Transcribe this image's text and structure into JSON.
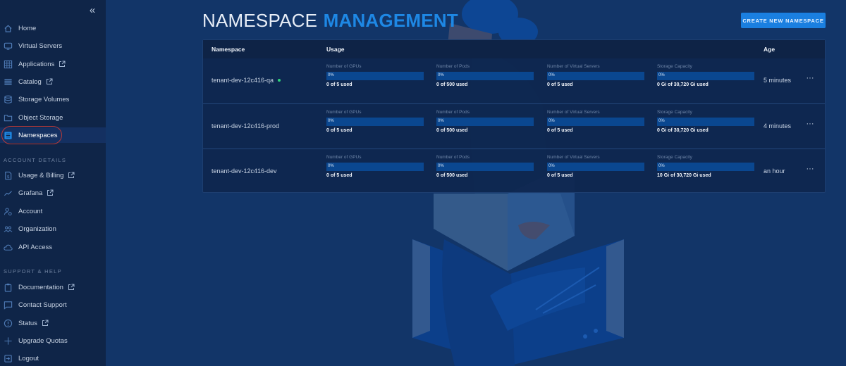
{
  "sidebar": {
    "collapse_label": "«",
    "items": [
      {
        "label": "Home",
        "icon": "home-icon",
        "external": false
      },
      {
        "label": "Virtual Servers",
        "icon": "monitor-icon",
        "external": false
      },
      {
        "label": "Applications",
        "icon": "grid-icon",
        "external": true
      },
      {
        "label": "Catalog",
        "icon": "list-icon",
        "external": true
      },
      {
        "label": "Storage Volumes",
        "icon": "database-icon",
        "external": false
      },
      {
        "label": "Object Storage",
        "icon": "folder-icon",
        "external": false
      },
      {
        "label": "Namespaces",
        "icon": "namespace-icon",
        "external": false,
        "active": true
      }
    ],
    "account_section": {
      "title": "ACCOUNT DETAILS",
      "items": [
        {
          "label": "Usage & Billing",
          "icon": "invoice-icon",
          "external": true
        },
        {
          "label": "Grafana",
          "icon": "chart-line-icon",
          "external": true
        },
        {
          "label": "Account",
          "icon": "user-gear-icon",
          "external": false
        },
        {
          "label": "Organization",
          "icon": "users-icon",
          "external": false
        },
        {
          "label": "API Access",
          "icon": "cloud-icon",
          "external": false
        }
      ]
    },
    "support_section": {
      "title": "SUPPORT & HELP",
      "items": [
        {
          "label": "Documentation",
          "icon": "clipboard-icon",
          "external": true
        },
        {
          "label": "Contact Support",
          "icon": "chat-icon",
          "external": false
        },
        {
          "label": "Status",
          "icon": "info-icon",
          "external": true
        },
        {
          "label": "Upgrade Quotas",
          "icon": "plus-icon",
          "external": false
        },
        {
          "label": "Logout",
          "icon": "logout-icon",
          "external": false
        }
      ]
    }
  },
  "header": {
    "title_light": "NAMESPACE",
    "title_bold": "MANAGEMENT",
    "create_button": "CREATE NEW NAMESPACE"
  },
  "table": {
    "columns": {
      "namespace": "Namespace",
      "usage": "Usage",
      "age": "Age"
    },
    "more_label": "···",
    "rows": [
      {
        "name": "tenant-dev-12c416-qa",
        "status_dot": true,
        "age": "5 minutes",
        "metrics": [
          {
            "label": "Number of GPUs",
            "percent": 0,
            "percent_text": "0%",
            "used_text": "0 of 5 used"
          },
          {
            "label": "Number of Pods",
            "percent": 0,
            "percent_text": "0%",
            "used_text": "0 of 500 used"
          },
          {
            "label": "Number of Virtual Servers",
            "percent": 0,
            "percent_text": "0%",
            "used_text": "0 of 5 used"
          },
          {
            "label": "Storage Capacity",
            "percent": 0,
            "percent_text": "0%",
            "used_text": "0 Gi of 30,720 Gi used"
          }
        ]
      },
      {
        "name": "tenant-dev-12c416-prod",
        "status_dot": false,
        "age": "4 minutes",
        "metrics": [
          {
            "label": "Number of GPUs",
            "percent": 0,
            "percent_text": "0%",
            "used_text": "0 of 5 used"
          },
          {
            "label": "Number of Pods",
            "percent": 0,
            "percent_text": "0%",
            "used_text": "0 of 500 used"
          },
          {
            "label": "Number of Virtual Servers",
            "percent": 0,
            "percent_text": "0%",
            "used_text": "0 of 5 used"
          },
          {
            "label": "Storage Capacity",
            "percent": 0,
            "percent_text": "0%",
            "used_text": "0 Gi of 30,720 Gi used"
          }
        ]
      },
      {
        "name": "tenant-dev-12c416-dev",
        "status_dot": false,
        "age": "an hour",
        "metrics": [
          {
            "label": "Number of GPUs",
            "percent": 0,
            "percent_text": "0%",
            "used_text": "0 of 5 used"
          },
          {
            "label": "Number of Pods",
            "percent": 0,
            "percent_text": "0%",
            "used_text": "0 of 500 used"
          },
          {
            "label": "Number of Virtual Servers",
            "percent": 0,
            "percent_text": "0%",
            "used_text": "0 of 5 used"
          },
          {
            "label": "Storage Capacity",
            "percent": 0,
            "percent_text": "0%",
            "used_text": "10 Gi of 30,720 Gi used"
          }
        ]
      }
    ]
  },
  "colors": {
    "accent": "#1e88e5",
    "sidebar_bg": "#0f2548",
    "page_bg": "#123568",
    "status_ok": "#2fd47a",
    "active_highlight": "#b53a3a"
  }
}
